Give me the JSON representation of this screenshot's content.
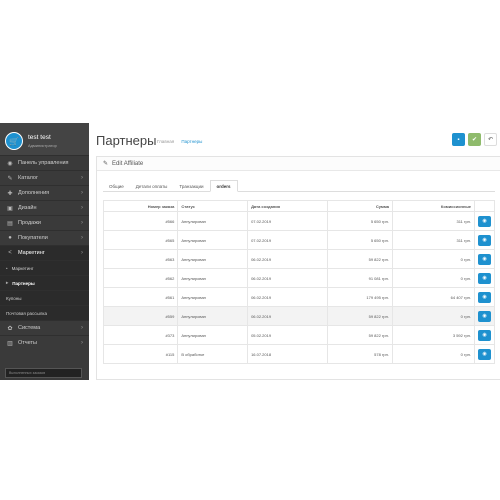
{
  "profile": {
    "name": "test test",
    "role": "Администратор"
  },
  "sidebar": {
    "items": [
      {
        "icon": "dashboard-icon",
        "glyph": "◉",
        "label": "Панель управления",
        "chevron": false
      },
      {
        "icon": "tag-icon",
        "glyph": "✎",
        "label": "Каталог",
        "chevron": true
      },
      {
        "icon": "puzzle-icon",
        "glyph": "✚",
        "label": "Дополнения",
        "chevron": true
      },
      {
        "icon": "monitor-icon",
        "glyph": "▣",
        "label": "Дизайн",
        "chevron": true
      },
      {
        "icon": "cart-icon",
        "glyph": "▤",
        "label": "Продажи",
        "chevron": true
      },
      {
        "icon": "user-icon",
        "glyph": "●",
        "label": "Покупатели",
        "chevron": true
      },
      {
        "icon": "share-icon",
        "glyph": "<",
        "label": "Маркетинг",
        "chevron": true
      }
    ],
    "subitems": [
      "Маркетинг",
      "Партнеры",
      "Купоны",
      "Почтовая рассылка"
    ],
    "bottom_items": [
      {
        "icon": "gear-icon",
        "glyph": "✿",
        "label": "Система",
        "chevron": true
      },
      {
        "icon": "chart-icon",
        "glyph": "▥",
        "label": "Отчеты",
        "chevron": true
      }
    ],
    "stats_label": "Выполненных заказов"
  },
  "header": {
    "title": "Партнеры",
    "crumb_home": "Главная",
    "crumb_current": "Партнеры"
  },
  "panel": {
    "title": "Edit Affiliate"
  },
  "tabs": [
    "Общие",
    "Детали оплаты",
    "Транзакции",
    "orders"
  ],
  "table": {
    "headers": [
      "Номер заказа",
      "Статус",
      "Дата создания",
      "Сумма",
      "Комиссионные"
    ],
    "rows": [
      {
        "order": "#566",
        "status": "Аннулирован",
        "date": "07.02.2019",
        "sum": "5 650 грн.",
        "commission": "311 грн."
      },
      {
        "order": "#565",
        "status": "Аннулирован",
        "date": "07.02.2019",
        "sum": "5 650 грн.",
        "commission": "311 грн."
      },
      {
        "order": "#563",
        "status": "Аннулирован",
        "date": "06.02.2019",
        "sum": "59 822 грн.",
        "commission": "0 грн."
      },
      {
        "order": "#562",
        "status": "Аннулирован",
        "date": "06.02.2019",
        "sum": "91 081 грн.",
        "commission": "0 грн."
      },
      {
        "order": "#561",
        "status": "Аннулирован",
        "date": "06.02.2019",
        "sum": "179 495 грн.",
        "commission": "64 407 грн."
      },
      {
        "order": "#559",
        "status": "Аннулирован",
        "date": "06.02.2019",
        "sum": "59 822 грн.",
        "commission": "0 грн."
      },
      {
        "order": "#373",
        "status": "Аннулирован",
        "date": "05.02.2019",
        "sum": "59 822 грн.",
        "commission": "3 592 грн."
      },
      {
        "order": "#115",
        "status": "В обработке",
        "date": "16.07.2018",
        "sum": "578 грн.",
        "commission": "0 грн."
      }
    ]
  }
}
